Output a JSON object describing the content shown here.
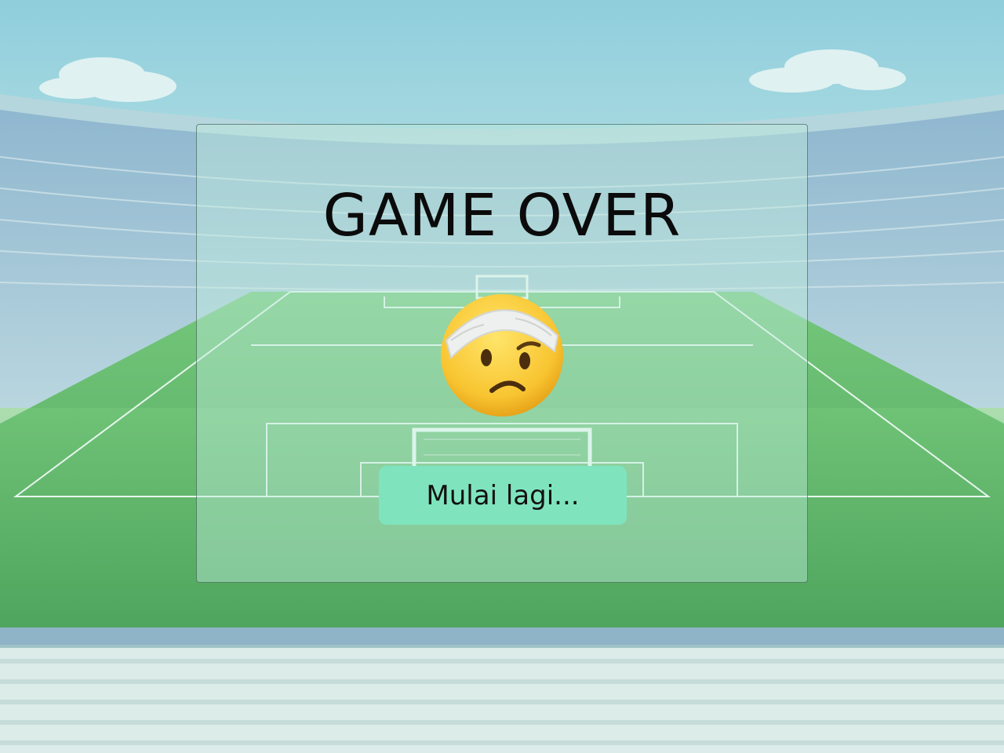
{
  "game_over": {
    "title": "GAME OVER",
    "icon": "face-with-head-bandage-icon",
    "restart_label": "Mulai lagi..."
  },
  "background": {
    "scene": "football-stadium",
    "colors": {
      "sky": "#a9d9e3",
      "pitch": "#5fb36c",
      "seats": "#dfeee8",
      "overlay_button": "#7fe4bd"
    }
  }
}
